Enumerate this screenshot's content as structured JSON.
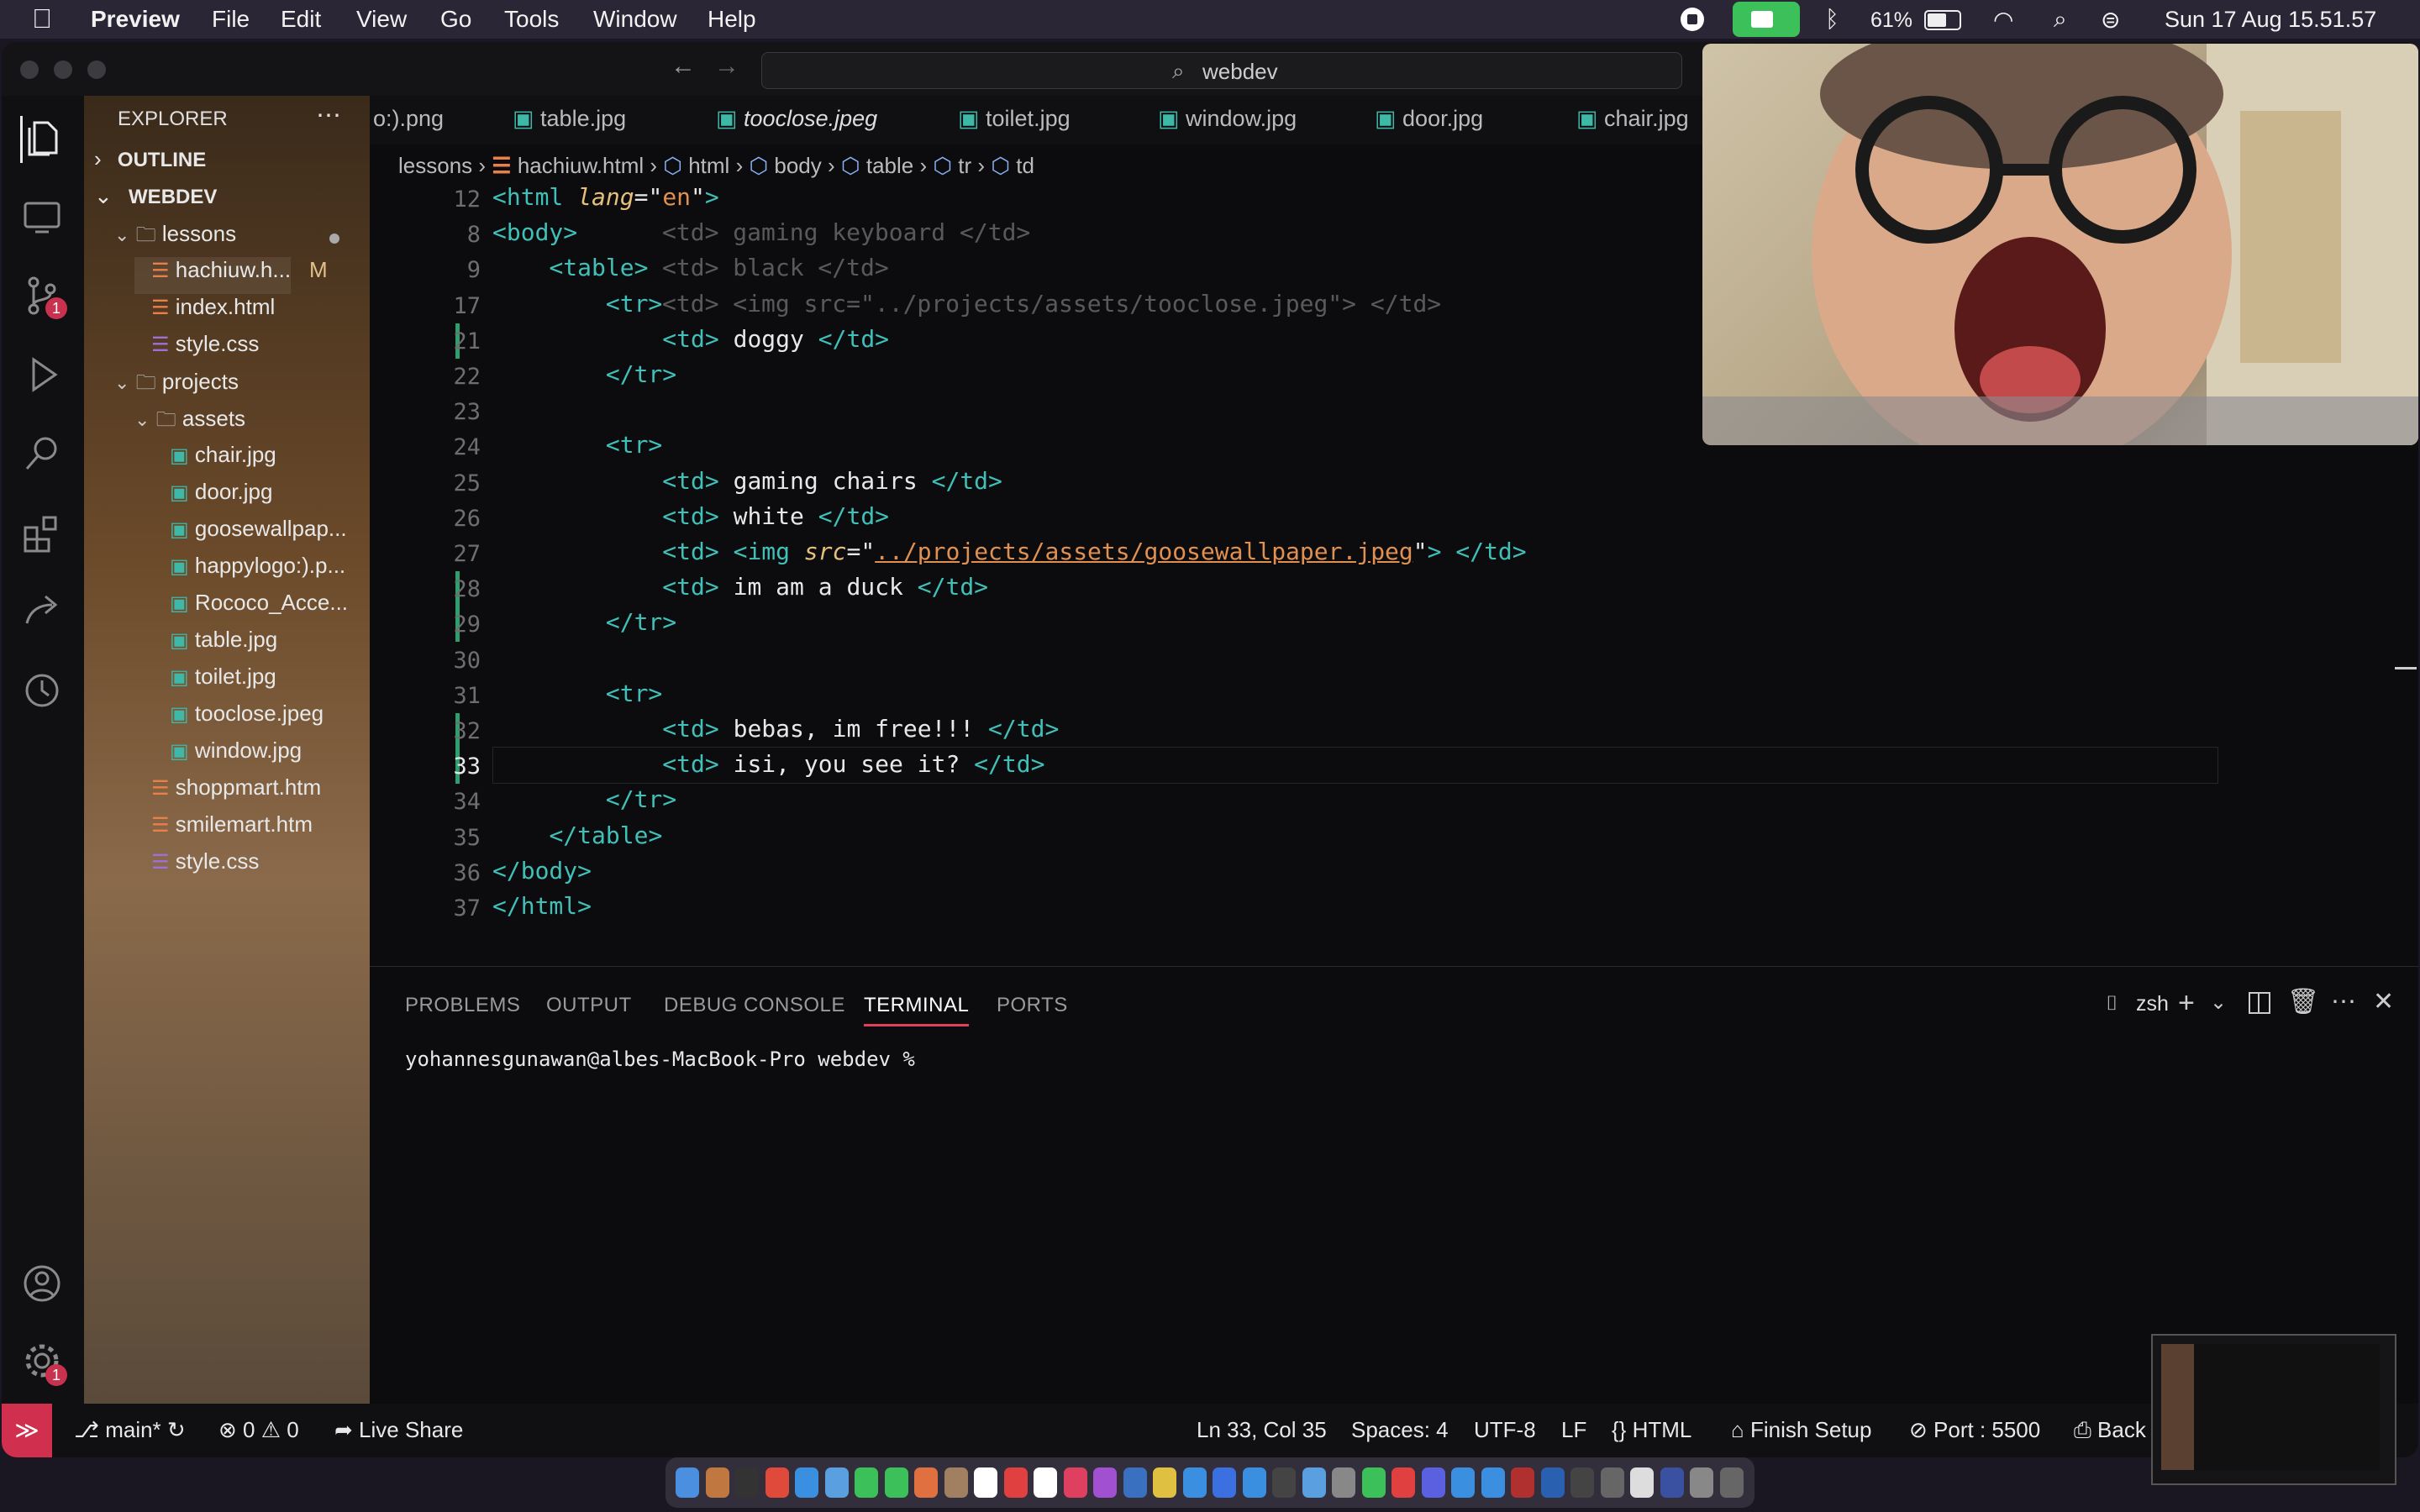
{
  "menubar": {
    "app": "Preview",
    "items": [
      "File",
      "Edit",
      "View",
      "Go",
      "Tools",
      "Window",
      "Help"
    ],
    "battery": "61%",
    "datetime": "Sun 17 Aug  15.51.57"
  },
  "titlebar": {
    "search": "webdev"
  },
  "activity": {
    "scm_badge": "1",
    "settings_badge": "1"
  },
  "sidebar": {
    "title": "EXPLORER",
    "outline": "OUTLINE",
    "workspace": "WEBDEV",
    "items": [
      {
        "label": "lessons",
        "type": "folder",
        "indent": 1
      },
      {
        "label": "hachiuw.h...",
        "type": "html",
        "indent": 2,
        "badge": "M"
      },
      {
        "label": "index.html",
        "type": "html",
        "indent": 2
      },
      {
        "label": "style.css",
        "type": "css",
        "indent": 2
      },
      {
        "label": "projects",
        "type": "folder",
        "indent": 1
      },
      {
        "label": "assets",
        "type": "folder",
        "indent": 2
      },
      {
        "label": "chair.jpg",
        "type": "img",
        "indent": 3
      },
      {
        "label": "door.jpg",
        "type": "img",
        "indent": 3
      },
      {
        "label": "goosewallpap...",
        "type": "img",
        "indent": 3
      },
      {
        "label": "happylogo:).p...",
        "type": "img",
        "indent": 3
      },
      {
        "label": "Rococo_Acce...",
        "type": "img",
        "indent": 3
      },
      {
        "label": "table.jpg",
        "type": "img",
        "indent": 3
      },
      {
        "label": "toilet.jpg",
        "type": "img",
        "indent": 3
      },
      {
        "label": "tooclose.jpeg",
        "type": "img",
        "indent": 3
      },
      {
        "label": "window.jpg",
        "type": "img",
        "indent": 3
      },
      {
        "label": "shoppmart.htm",
        "type": "html",
        "indent": 2
      },
      {
        "label": "smilemart.htm",
        "type": "html",
        "indent": 2
      },
      {
        "label": "style.css",
        "type": "css",
        "indent": 2
      }
    ]
  },
  "tabs": [
    "o:).png",
    "table.jpg",
    "tooclose.jpeg",
    "toilet.jpg",
    "window.jpg",
    "door.jpg",
    "chair.jpg"
  ],
  "breadcrumb": [
    "lessons",
    "hachiuw.html",
    "html",
    "body",
    "table",
    "tr",
    "td"
  ],
  "code": {
    "sticky": [
      {
        "ln": "12",
        "html": "<span class=\"tag\">&lt;html</span> <span class=\"attr\">lang</span><span class=\"txt\">=\"</span><span class=\"str\">en</span><span class=\"txt\">\"</span><span class=\"tag\">&gt;</span>"
      },
      {
        "ln": "8",
        "html": "<span class=\"tag\">&lt;body&gt;</span>"
      },
      {
        "ln": "9",
        "html": "    <span class=\"tag\">&lt;table&gt;</span>"
      },
      {
        "ln": "17",
        "html": "        <span class=\"tag\">&lt;tr&gt;</span>"
      }
    ],
    "ghost": [
      "&lt;td&gt; gaming keyboard &lt;/td&gt;",
      "&lt;td&gt; black &lt;/td&gt;",
      "&lt;td&gt; &lt;img src=\"../projects/assets/tooclose.jpeg\"&gt; &lt;/td&gt;"
    ],
    "lines": [
      {
        "ln": "21",
        "mod": true,
        "html": "            <span class=\"tag\">&lt;td&gt;</span><span class=\"txt\"> doggy </span><span class=\"tag\">&lt;/td&gt;</span>"
      },
      {
        "ln": "22",
        "html": "        <span class=\"tag\">&lt;/tr&gt;</span>"
      },
      {
        "ln": "23",
        "html": ""
      },
      {
        "ln": "24",
        "html": "        <span class=\"tag\">&lt;tr&gt;</span>"
      },
      {
        "ln": "25",
        "html": "            <span class=\"tag\">&lt;td&gt;</span><span class=\"txt\"> gaming chairs </span><span class=\"tag\">&lt;/td&gt;</span>"
      },
      {
        "ln": "26",
        "html": "            <span class=\"tag\">&lt;td&gt;</span><span class=\"txt\"> white </span><span class=\"tag\">&lt;/td&gt;</span>"
      },
      {
        "ln": "27",
        "html": "            <span class=\"tag\">&lt;td&gt;</span> <span class=\"tag\">&lt;img</span> <span class=\"attr\">src</span><span class=\"txt\">=\"</span><span class=\"str\" style=\"text-decoration:underline\">../projects/assets/goosewallpaper.jpeg</span><span class=\"txt\">\"</span><span class=\"tag\">&gt;</span> <span class=\"tag\">&lt;/td&gt;</span>"
      },
      {
        "ln": "28",
        "mod": true,
        "html": "            <span class=\"tag\">&lt;td&gt;</span><span class=\"txt\"> im am a duck </span><span class=\"tag\">&lt;/td&gt;</span>"
      },
      {
        "ln": "29",
        "mod": true,
        "html": "        <span class=\"tag\">&lt;/tr&gt;</span>"
      },
      {
        "ln": "30",
        "html": ""
      },
      {
        "ln": "31",
        "html": "        <span class=\"tag\">&lt;tr&gt;</span>"
      },
      {
        "ln": "32",
        "mod": true,
        "html": "            <span class=\"tag\">&lt;td&gt;</span><span class=\"txt\"> bebas, im free!!! </span><span class=\"tag\">&lt;/td&gt;</span>"
      },
      {
        "ln": "33",
        "mod": true,
        "cur": true,
        "html": "            <span class=\"tag\">&lt;td&gt;</span><span class=\"txt\"> isi, you see it? </span><span class=\"tag\">&lt;/td&gt;</span>"
      },
      {
        "ln": "34",
        "html": "        <span class=\"tag\">&lt;/tr&gt;</span>"
      },
      {
        "ln": "35",
        "html": "    <span class=\"tag\">&lt;/table&gt;</span>"
      },
      {
        "ln": "36",
        "html": "<span class=\"tag\">&lt;/body&gt;</span>"
      },
      {
        "ln": "37",
        "html": "<span class=\"tag\">&lt;/html&gt;</span>"
      }
    ]
  },
  "panel": {
    "tabs": [
      "PROBLEMS",
      "OUTPUT",
      "DEBUG CONSOLE",
      "TERMINAL",
      "PORTS"
    ],
    "active": "TERMINAL",
    "shell": "zsh",
    "prompt": "yohannesgunawan@albes-MacBook-Pro webdev %"
  },
  "status": {
    "branch": "main*",
    "errors": "0",
    "warnings": "0",
    "liveshare": "Live Share",
    "position": "Ln 33, Col 35",
    "spaces": "Spaces: 4",
    "encoding": "UTF-8",
    "eol": "LF",
    "language": "HTML",
    "finish": "Finish Setup",
    "port": "Port : 5500",
    "back": "Back"
  }
}
